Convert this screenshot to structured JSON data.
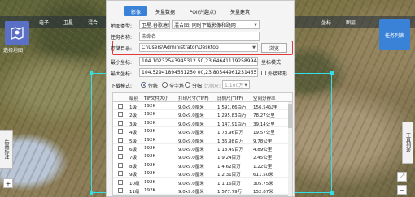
{
  "map_nav": {
    "items": [
      "电子",
      "卫星",
      "混合",
      "地形"
    ],
    "right_items": [
      "坐标",
      "图层",
      "工具"
    ]
  },
  "left_panel": {
    "select_map_label": "选择地图",
    "vector_mark_label": "矢量标注"
  },
  "right_panel": {
    "task_list_label": "任务列表",
    "toolbox_label": "工具列表",
    "zoom_in": "+",
    "zoom_out": "−",
    "fit": "⤢"
  },
  "dialog": {
    "tabs": [
      {
        "label": "影像",
        "active": true
      },
      {
        "label": "矢量数据",
        "active": false
      },
      {
        "label": "POI(兴趣点)",
        "active": false
      },
      {
        "label": "矢量建筑",
        "active": false
      }
    ],
    "map_type": {
      "label": "地图类型:",
      "value1": "卫星.谷歌地图",
      "value2": "混合图: 同时下载影像和路网"
    },
    "task_name": {
      "label": "任务名称:",
      "value": "未命名"
    },
    "save_dir": {
      "label": "存储目录:",
      "value": "C:\\Users\\Administrator\\Desktop",
      "browse_label": "浏览"
    },
    "min_coord": {
      "label": "最小坐标:",
      "value": "104.10232543945312 50,23.6464111925899445",
      "mode_label": "坐标模式"
    },
    "max_coord": {
      "label": "最大坐标:",
      "value": "104.52941894531250 00,23.8054496123146510",
      "outer_label": "外接矩形"
    },
    "download_mode": {
      "label": "下载模式:",
      "options": [
        {
          "label": "传统",
          "selected": true
        },
        {
          "label": "全字塔",
          "selected": false
        },
        {
          "label": "分幅",
          "selected": false
        }
      ],
      "scale_label": "比例尺:",
      "scale_value": "1:100万"
    },
    "table": {
      "headers": [
        "级别",
        "TIF文件大小",
        "打印尺寸(TIFF)",
        "比例尺(TIFF)",
        "空间分辨率"
      ],
      "rows": [
        [
          "1级",
          "192K",
          "9.0x9.0厘米",
          "1:591.66百万",
          "156.54公里"
        ],
        [
          "2级",
          "192K",
          "9.0x9.0厘米",
          "1:295.83百万",
          "78.27公里"
        ],
        [
          "3级",
          "192K",
          "9.0x9.0厘米",
          "1:147.91百万",
          "39.14公里"
        ],
        [
          "4级",
          "192K",
          "9.0x9.0厘米",
          "1:73.96百万",
          "19.57公里"
        ],
        [
          "5级",
          "192K",
          "9.0x9.0厘米",
          "1:36.98百万",
          "9.78公里"
        ],
        [
          "6级",
          "192K",
          "9.0x9.0厘米",
          "1:18.49百万",
          "4.89公里"
        ],
        [
          "7级",
          "192K",
          "9.0x9.0厘米",
          "1:9.24百万",
          "2.45公里"
        ],
        [
          "8级",
          "192K",
          "9.0x9.0厘米",
          "1:4.62百万",
          "1.22公里"
        ],
        [
          "9级",
          "192K",
          "9.0x9.0厘米",
          "1:2.31百万",
          "611.50米"
        ],
        [
          "10级",
          "192K",
          "9.0x9.0厘米",
          "1:1.16百万",
          "305.75米"
        ],
        [
          "11级",
          "192K",
          "9.0x9.0厘米",
          "1:577.79万",
          "152.87米"
        ]
      ]
    }
  },
  "colors": {
    "accent": "#3a82d8",
    "selection": "#33e0e6",
    "highlight": "#e23a3a"
  }
}
